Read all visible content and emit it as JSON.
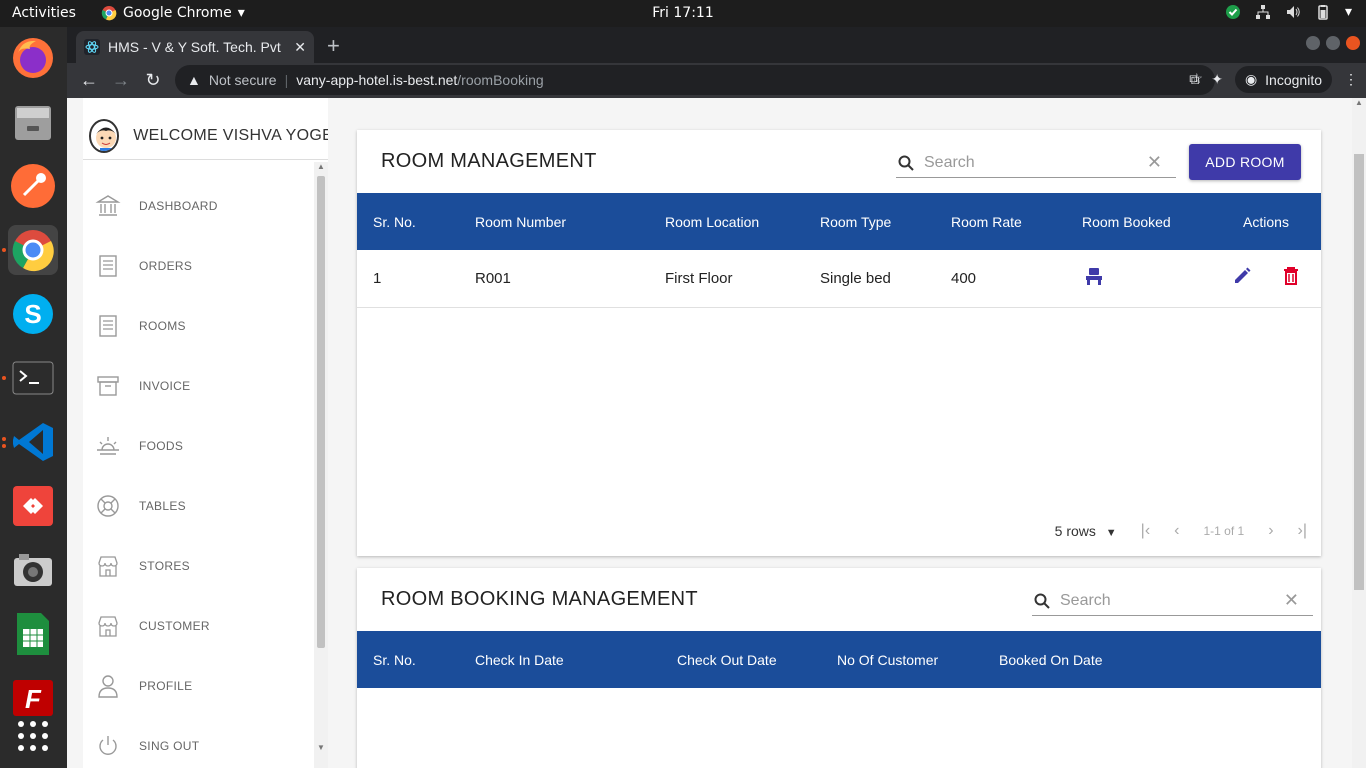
{
  "topbar": {
    "activities": "Activities",
    "app": "Google Chrome",
    "clock": "Fri 17:11"
  },
  "dock": {
    "items": [
      "firefox-icon",
      "files-icon",
      "postman-icon",
      "chrome-icon",
      "skype-icon",
      "terminal-icon",
      "vscode-icon",
      "anydesk-icon",
      "camera-icon",
      "spreadsheet-icon",
      "filezilla-icon",
      "app-grid-icon"
    ]
  },
  "browser": {
    "tab_title": "HMS - V & Y Soft. Tech. Pvt",
    "not_secure": "Not secure",
    "url_host": "vany-app-hotel.is-best.net",
    "url_path": "/roomBooking",
    "incognito": "Incognito"
  },
  "sidebar": {
    "welcome": "WELCOME VISHVA YOGESH",
    "items": [
      {
        "label": "DASHBOARD",
        "icon": "bank-icon"
      },
      {
        "label": "ORDERS",
        "icon": "document-icon"
      },
      {
        "label": "ROOMS",
        "icon": "document-icon"
      },
      {
        "label": "INVOICE",
        "icon": "archive-icon"
      },
      {
        "label": "FOODS",
        "icon": "sunrise-icon"
      },
      {
        "label": "TABLES",
        "icon": "lifebuoy-icon"
      },
      {
        "label": "STORES",
        "icon": "store-icon"
      },
      {
        "label": "CUSTOMER",
        "icon": "store-icon"
      },
      {
        "label": "PROFILE",
        "icon": "person-icon"
      },
      {
        "label": "SING OUT",
        "icon": "power-icon"
      }
    ]
  },
  "room_management": {
    "title": "ROOM MANAGEMENT",
    "search_placeholder": "Search",
    "add_button": "ADD ROOM",
    "columns": [
      "Sr. No.",
      "Room Number",
      "Room Location",
      "Room Type",
      "Room Rate",
      "Room Booked",
      "Actions"
    ],
    "rows": [
      {
        "sr": "1",
        "number": "R001",
        "location": "First Floor",
        "type": "Single bed",
        "rate": "400"
      }
    ],
    "rows_per_page": "5 rows",
    "page_info": "1-1 of 1"
  },
  "booking_management": {
    "title": "ROOM BOOKING MANAGEMENT",
    "search_placeholder": "Search",
    "columns": [
      "Sr. No.",
      "Check In Date",
      "Check Out Date",
      "No Of Customer",
      "Booked On Date"
    ]
  },
  "colors": {
    "table_header": "#1b4d9a",
    "primary_button": "#3f3aa9",
    "delete": "#e0002a",
    "edit": "#3f3aa9"
  }
}
